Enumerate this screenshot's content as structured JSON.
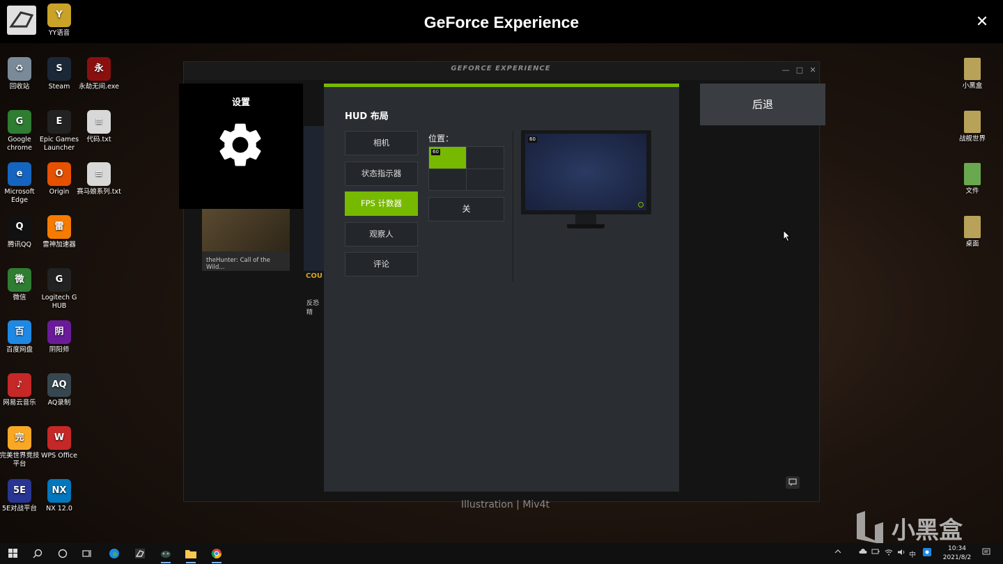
{
  "overlay": {
    "title": "GeForce Experience",
    "close_glyph": "✕"
  },
  "gfe_window": {
    "logo": "GEFORCE EXPERIENCE",
    "minimize": "—",
    "maximize": "□",
    "close": "✕",
    "game_cards": [
      {
        "label": "theHunter: Call of the Wild..."
      },
      {
        "label": "反恐精",
        "title_fragment": "COU"
      }
    ]
  },
  "settings_tile": {
    "label": "设置",
    "icon": "gear-icon"
  },
  "hud": {
    "title": "HUD 布局",
    "accent_color": "#76b900",
    "menu": [
      {
        "label": "相机",
        "active": false
      },
      {
        "label": "状态指示器",
        "active": false
      },
      {
        "label": "FPS 计数器",
        "active": true
      },
      {
        "label": "观察人",
        "active": false
      },
      {
        "label": "评论",
        "active": false
      }
    ],
    "position_label": "位置：",
    "fps_value": "60",
    "toggle_label": "关",
    "monitor_fps": "60"
  },
  "back_button": {
    "label": "后退"
  },
  "wallpaper_credit": "Illustration | Miv4t",
  "watermark": "小黑盒",
  "desktop_left": [
    {
      "label": "YY语音",
      "color": "#c9a227",
      "glyph": "Y"
    },
    {
      "label": "回收站",
      "color": "#7a8a99",
      "glyph": "♻"
    },
    {
      "label": "Steam",
      "color": "#1b2838",
      "glyph": "S"
    },
    {
      "label": "永劫无间.exe",
      "color": "#8a1010",
      "glyph": "永"
    },
    {
      "label": "Google chrome",
      "color": "#2e7d32",
      "glyph": "G"
    },
    {
      "label": "Epic Games Launcher",
      "color": "#222222",
      "glyph": "E"
    },
    {
      "label": "代码.txt",
      "color": "#d8d8d8",
      "glyph": "≡"
    },
    {
      "label": "Microsoft Edge",
      "color": "#1565c0",
      "glyph": "e"
    },
    {
      "label": "Origin",
      "color": "#e65100",
      "glyph": "O"
    },
    {
      "label": "赛马娘系列.txt",
      "color": "#d8d8d8",
      "glyph": "≡"
    },
    {
      "label": "腾讯QQ",
      "color": "#111111",
      "glyph": "Q"
    },
    {
      "label": "雷神加速器",
      "color": "#f57c00",
      "glyph": "雷"
    },
    {
      "label": "微信",
      "color": "#2e7d32",
      "glyph": "微"
    },
    {
      "label": "Logitech G HUB",
      "color": "#222222",
      "glyph": "G"
    },
    {
      "label": "百度网盘",
      "color": "#1e88e5",
      "glyph": "百"
    },
    {
      "label": "阴阳师",
      "color": "#6a1b9a",
      "glyph": "阴"
    },
    {
      "label": "网易云音乐",
      "color": "#c62828",
      "glyph": "♪"
    },
    {
      "label": "AQ录制",
      "color": "#37474f",
      "glyph": "AQ"
    },
    {
      "label": "完美世界竞技平台",
      "color": "#f9a825",
      "glyph": "完"
    },
    {
      "label": "WPS Office",
      "color": "#c62828",
      "glyph": "W"
    },
    {
      "label": "5E对战平台",
      "color": "#283593",
      "glyph": "5E"
    },
    {
      "label": "NX 12.0",
      "color": "#0277bd",
      "glyph": "NX"
    }
  ],
  "desktop_right": [
    {
      "label": "小黑盒",
      "color": "#b8a25a",
      "glyph": "▮"
    },
    {
      "label": "战舰世界",
      "color": "#b8a25a",
      "glyph": "▮"
    },
    {
      "label": "文件",
      "color": "#6aa84f",
      "glyph": "▮"
    },
    {
      "label": "桌面",
      "color": "#b8a25a",
      "glyph": "▮"
    }
  ],
  "taskbar": {
    "time": "10:34",
    "date": "2021/8/2",
    "ime": "中"
  }
}
